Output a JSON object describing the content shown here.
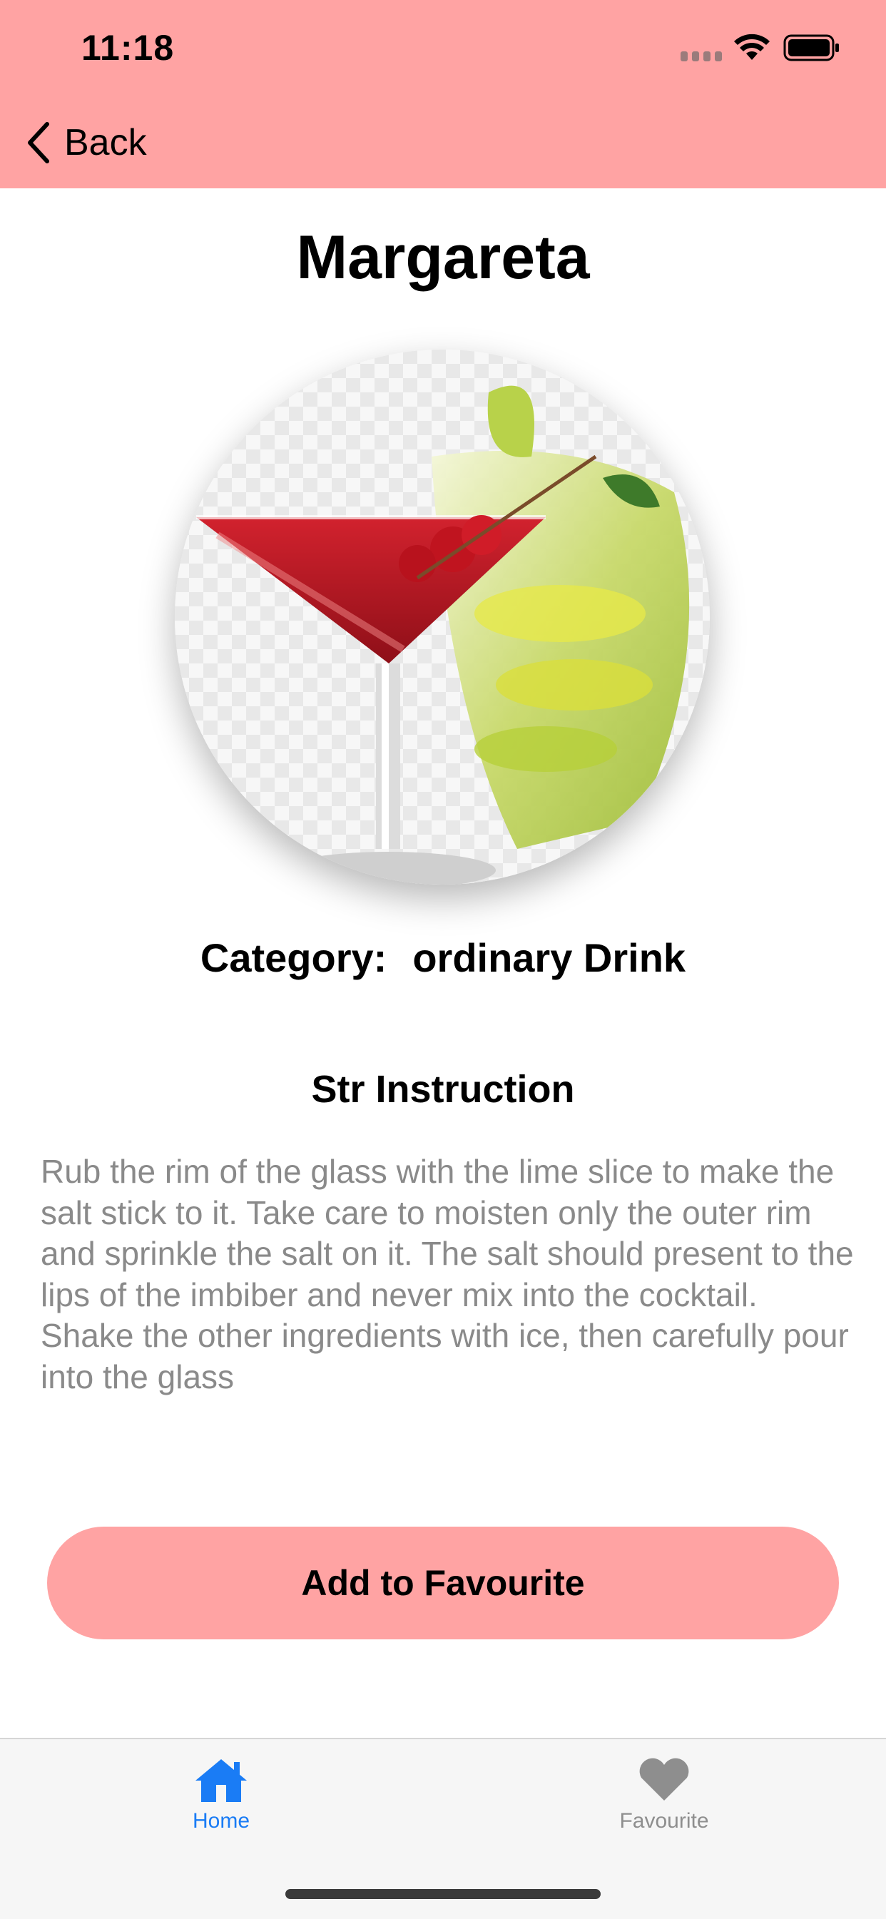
{
  "status_bar": {
    "time": "11:18"
  },
  "nav": {
    "back_label": "Back"
  },
  "drink": {
    "name": "Margareta",
    "category_label": "Category:",
    "category_value": "ordinary Drink",
    "instruction_title": "Str Instruction",
    "instructions": "Rub the rim of the glass with the lime slice to make the salt stick to it. Take care to moisten only the outer rim and sprinkle the salt on it. The salt should present to the lips of the imbiber and never mix into the cocktail. Shake the other ingredients with ice, then carefully pour into the glass"
  },
  "actions": {
    "add_favourite_label": "Add to Favourite"
  },
  "tab_bar": {
    "items": [
      {
        "label": "Home",
        "icon": "house-icon",
        "active": true
      },
      {
        "label": "Favourite",
        "icon": "heart-icon",
        "active": false
      }
    ]
  },
  "colors": {
    "accent": "#ffa3a3",
    "active_tab": "#1a7cf5",
    "inactive_tab": "#8e8e8e",
    "instruction_text": "#8a8a8a"
  }
}
